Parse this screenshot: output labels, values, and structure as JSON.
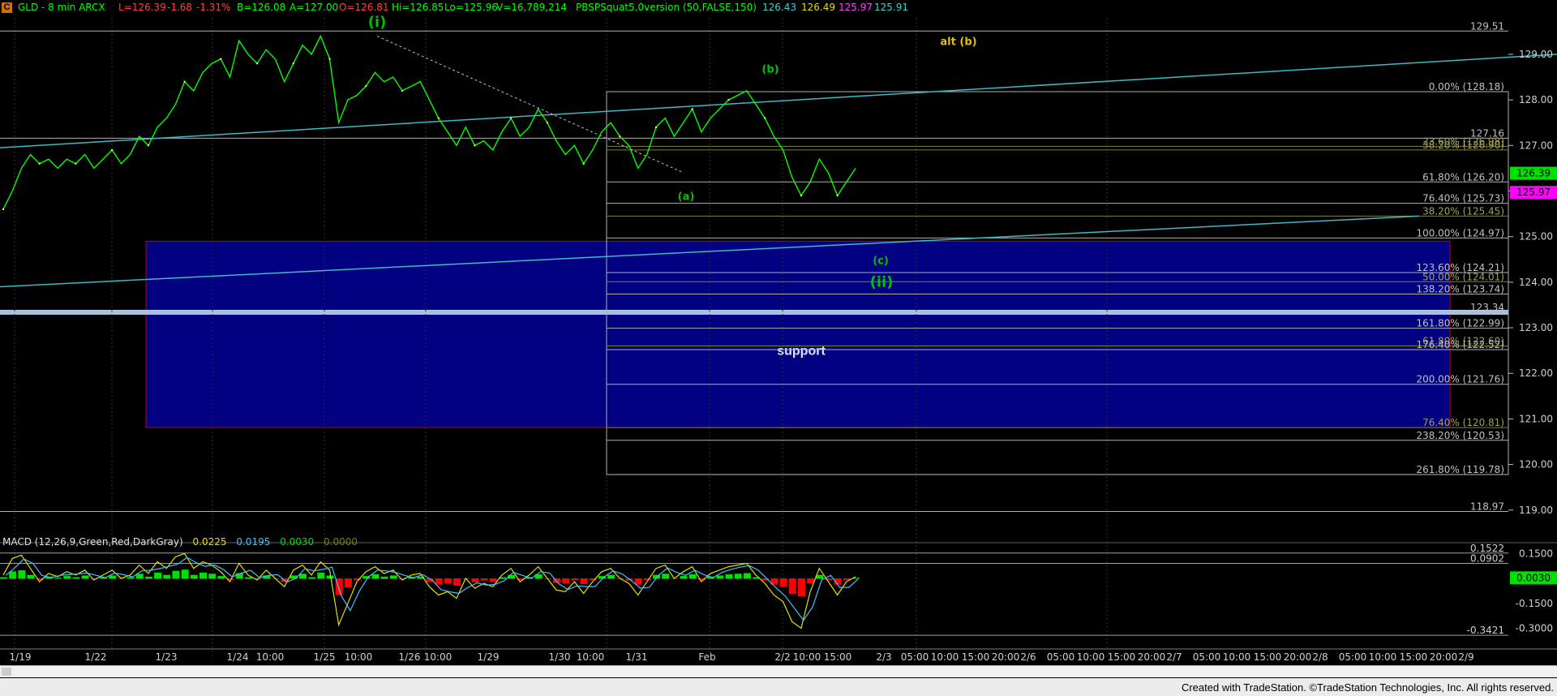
{
  "header": {
    "badge": "C",
    "symbol": "GLD - 8 min ARCX",
    "last": "L=126.39",
    "change": "-1.68",
    "change_pct": "-1.31%",
    "bid": "B=126.08",
    "ask": "A=127.00",
    "open": "O=126.81",
    "high": "Hi=126.85",
    "low": "Lo=125.96",
    "volume": "V=16,789,214",
    "study": "PBSPSquat5.0version (50,FALSE,150)",
    "study_v1": "126.43",
    "study_v2": "126.49",
    "study_v3": "125.97",
    "study_v4": "125.91"
  },
  "macd_header": {
    "label": "MACD (12,26,9,Green,Red,DarkGray)",
    "v1": "0.0225",
    "v2": "0.0195",
    "v3": "0.0030",
    "v4": "0.0000"
  },
  "footer": "Created with TradeStation. ©TradeStation Technologies, Inc. All rights reserved.",
  "colors": {
    "background": "#000000",
    "price": "#00ff00",
    "trendline": "#3fb8c8",
    "support_box": "#000080",
    "wave_label": "#00c000",
    "alt_label": "#e0c000",
    "level_line": "#b0b0b0",
    "fib_text": "#c0c0c0",
    "macd_pos": "#00e000",
    "macd_neg": "#ff0000"
  },
  "chart_data": {
    "type": "line",
    "title": "GLD - 8 min ARCX",
    "ylim": [
      118.8,
      129.8
    ],
    "y_ticks": [
      "129.00",
      "128.00",
      "127.00",
      "126.00",
      "125.00",
      "124.00",
      "123.00",
      "122.00",
      "121.00",
      "120.00",
      "119.00"
    ],
    "x_ticks": [
      "1/19",
      "1/22",
      "1/23",
      "1/24",
      "10:00",
      "1/25",
      "10:00",
      "1/26",
      "10:00",
      "1/29",
      "1/30",
      "10:00",
      "1/31",
      "Feb",
      "2/2",
      "10:00",
      "15:00",
      "2/3",
      "05:00",
      "10:00",
      "15:00",
      "20:00",
      "2/6",
      "05:00",
      "10:00",
      "15:00",
      "20:00",
      "2/7",
      "05:00",
      "10:00",
      "15:00",
      "20:00",
      "2/8",
      "05:00",
      "10:00",
      "15:00",
      "20:00",
      "2/9"
    ],
    "price_series": {
      "name": "GLD",
      "values": [
        125.6,
        126.0,
        126.5,
        126.8,
        126.6,
        126.7,
        126.5,
        126.7,
        126.6,
        126.8,
        126.5,
        126.7,
        126.9,
        126.6,
        126.8,
        127.2,
        127.0,
        127.4,
        127.6,
        127.9,
        128.4,
        128.2,
        128.6,
        128.8,
        128.9,
        128.5,
        129.3,
        129.0,
        128.8,
        129.1,
        128.9,
        128.4,
        128.8,
        129.2,
        129.0,
        129.4,
        128.9,
        127.5,
        128.0,
        128.1,
        128.3,
        128.6,
        128.4,
        128.5,
        128.2,
        128.3,
        128.4,
        128.0,
        127.6,
        127.3,
        127.0,
        127.4,
        127.0,
        127.1,
        126.9,
        127.3,
        127.6,
        127.2,
        127.4,
        127.8,
        127.5,
        127.1,
        126.8,
        127.0,
        126.6,
        126.9,
        127.3,
        127.5,
        127.2,
        127.0,
        126.5,
        126.8,
        127.4,
        127.6,
        127.2,
        127.5,
        127.8,
        127.3,
        127.6,
        127.8,
        128.0,
        128.1,
        128.2,
        127.9,
        127.6,
        127.2,
        126.9,
        126.3,
        125.9,
        126.2,
        126.7,
        126.4,
        125.9,
        126.2,
        126.5
      ]
    },
    "levels": [
      {
        "value": 129.51,
        "label": "129.51"
      },
      {
        "value": 128.18,
        "label": "0.00% (128.18)"
      },
      {
        "value": 127.16,
        "label": "127.16"
      },
      {
        "value": 126.98,
        "label": "23.60% (126.98)"
      },
      {
        "value": 126.9,
        "label": "38.20% (126.90)"
      },
      {
        "value": 126.2,
        "label": "61.80% (126.20)"
      },
      {
        "value": 125.73,
        "label": "76.40% (125.73)"
      },
      {
        "value": 125.45,
        "label": "38.20% (125.45)"
      },
      {
        "value": 124.97,
        "label": "100.00% (124.97)"
      },
      {
        "value": 124.21,
        "label": "123.60% (124.21)"
      },
      {
        "value": 124.01,
        "label": "50.00% (124.01)"
      },
      {
        "value": 123.74,
        "label": "138.20% (123.74)"
      },
      {
        "value": 123.34,
        "label": "123.34"
      },
      {
        "value": 122.99,
        "label": "161.80% (122.99)"
      },
      {
        "value": 122.6,
        "label": "61.80% (122.60)"
      },
      {
        "value": 122.52,
        "label": "176.40% (122.52)"
      },
      {
        "value": 121.76,
        "label": "200.00% (121.76)"
      },
      {
        "value": 120.81,
        "label": "76.40% (120.81)"
      },
      {
        "value": 120.53,
        "label": "238.20% (120.53)"
      },
      {
        "value": 119.78,
        "label": "261.80% (119.78)"
      },
      {
        "value": 118.97,
        "label": "118.97"
      }
    ],
    "right_badges": [
      {
        "value": 126.39,
        "label": "126.39",
        "color": "#00e000"
      },
      {
        "value": 125.97,
        "label": "125.97",
        "color": "#ff00ff"
      }
    ],
    "support_zone": {
      "top": 124.97,
      "bottom": 120.81,
      "label": "support"
    },
    "wave_labels": [
      {
        "text": "(i)",
        "value": 129.6
      },
      {
        "text": "(b)",
        "value": 128.6
      },
      {
        "text": "(a)",
        "value": 125.8
      },
      {
        "text": "(c)",
        "value": 124.4
      },
      {
        "text": "(ii)",
        "value": 123.9
      },
      {
        "text": "alt (b)",
        "value": 129.2
      }
    ],
    "macd": {
      "ylim": [
        -0.4,
        0.2
      ],
      "y_ticks": [
        "0.1500",
        "0.0000",
        "-0.1500",
        "-0.3000"
      ],
      "marked_levels": [
        {
          "value": 0.1522,
          "label": "0.1522"
        },
        {
          "value": 0.0902,
          "label": "0.0902"
        },
        {
          "value": -0.3421,
          "label": "-0.3421"
        }
      ],
      "current": {
        "value": 0.003,
        "label": "0.0030"
      },
      "macd_values": [
        0.02,
        0.12,
        0.14,
        0.06,
        -0.02,
        0.03,
        0.01,
        0.04,
        0.02,
        0.05,
        -0.01,
        0.02,
        0.05,
        0.0,
        0.02,
        0.08,
        0.03,
        0.1,
        0.06,
        0.13,
        0.15,
        0.06,
        0.1,
        0.08,
        0.04,
        -0.02,
        0.09,
        0.02,
        -0.01,
        0.05,
        0.0,
        -0.05,
        0.05,
        0.08,
        0.02,
        0.1,
        0.05,
        -0.28,
        -0.15,
        -0.02,
        0.04,
        0.07,
        0.03,
        0.05,
        -0.01,
        0.02,
        0.03,
        -0.05,
        -0.1,
        -0.08,
        -0.12,
        0.0,
        -0.06,
        -0.03,
        -0.05,
        0.02,
        0.06,
        -0.02,
        0.02,
        0.07,
        0.0,
        -0.07,
        -0.08,
        -0.02,
        -0.09,
        -0.02,
        0.04,
        0.06,
        0.0,
        -0.03,
        -0.1,
        -0.02,
        0.06,
        0.08,
        0.0,
        0.04,
        0.07,
        -0.02,
        0.03,
        0.05,
        0.07,
        0.08,
        0.09,
        0.02,
        -0.03,
        -0.1,
        -0.14,
        -0.26,
        -0.3,
        -0.08,
        0.06,
        -0.02,
        -0.1,
        -0.02,
        0.01
      ]
    }
  }
}
